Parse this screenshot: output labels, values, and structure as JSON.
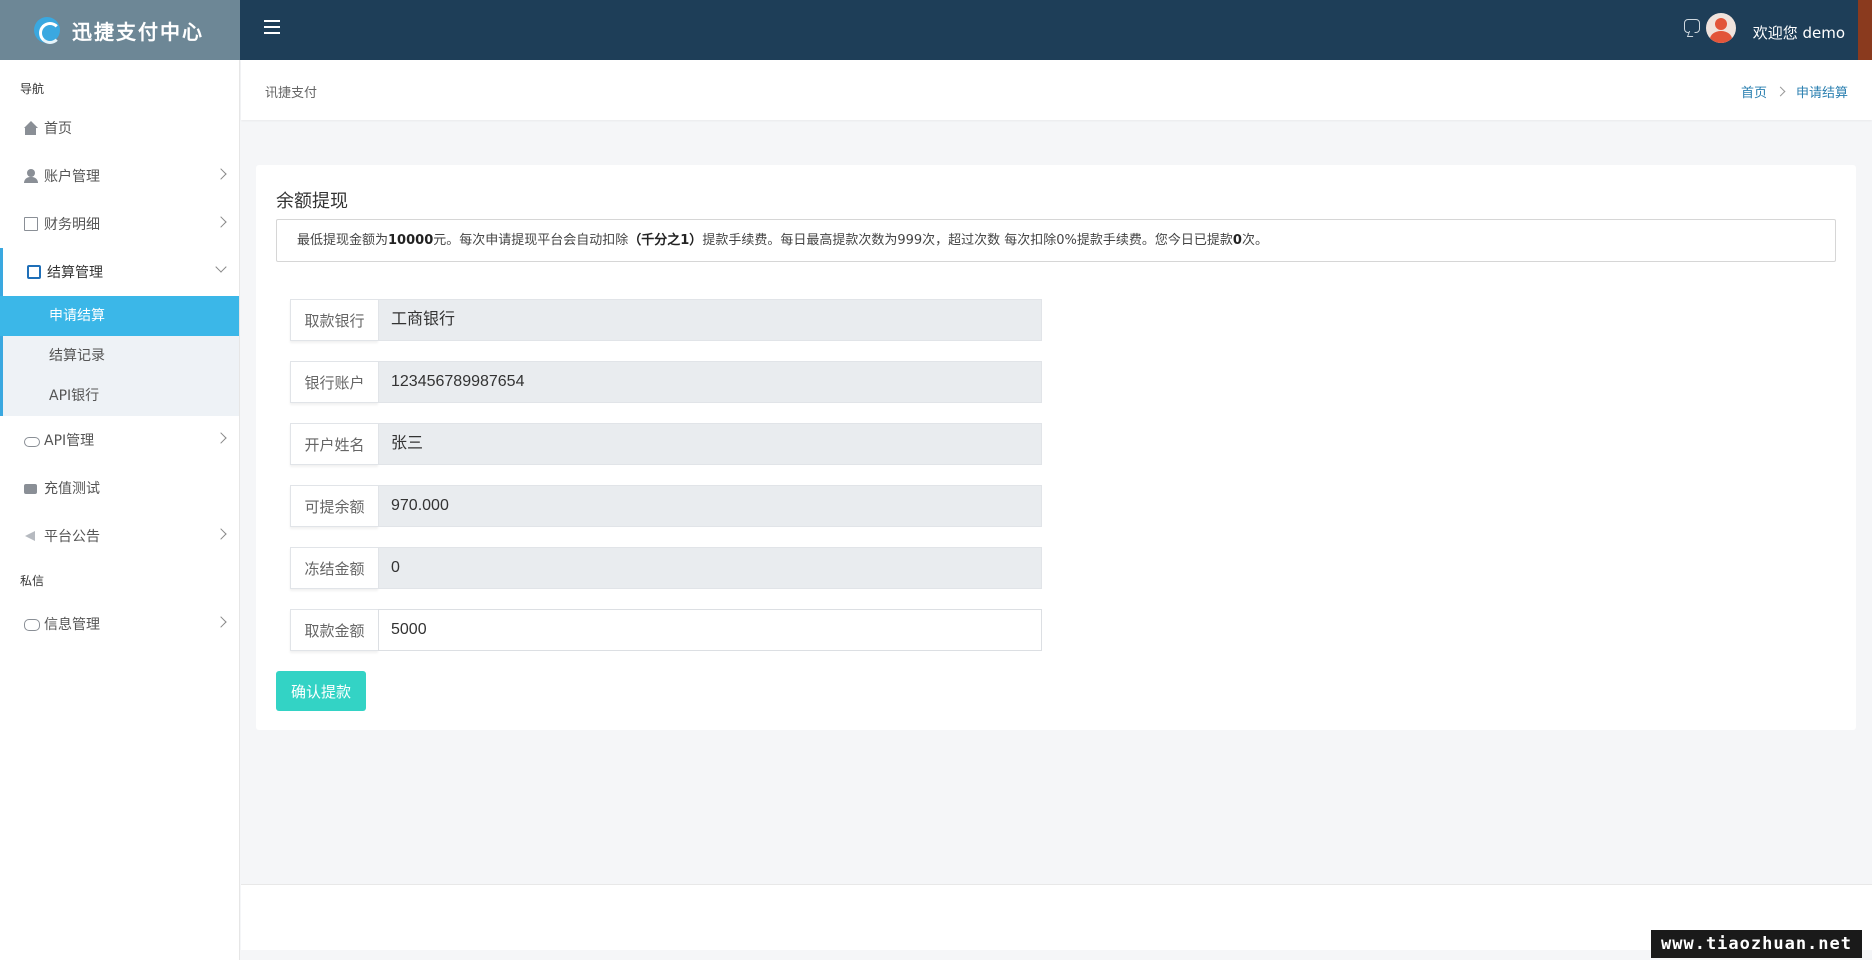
{
  "brand": {
    "title": "迅捷支付中心"
  },
  "header": {
    "welcome": "欢迎您 demo"
  },
  "sidebar": {
    "section_nav": "导航",
    "section_private": "私信",
    "items": [
      {
        "label": "首页"
      },
      {
        "label": "账户管理"
      },
      {
        "label": "财务明细"
      },
      {
        "label": "结算管理"
      },
      {
        "label": "API管理"
      },
      {
        "label": "充值测试"
      },
      {
        "label": "平台公告"
      },
      {
        "label": "信息管理"
      }
    ],
    "settlement_sub": [
      {
        "label": "申请结算"
      },
      {
        "label": "结算记录"
      },
      {
        "label": "API银行"
      }
    ]
  },
  "breadcrumb": {
    "left": "讯捷支付",
    "home": "首页",
    "current": "申请结算"
  },
  "card": {
    "title": "余额提现",
    "notice": {
      "p1": "最低提现金额为",
      "min_amount": "10000",
      "p2": "元。每次申请提现平台会自动扣除",
      "fee_rate": "（千分之1）",
      "p3": "提款手续费。每日最高提款次数为999次，超过次数 每次扣除0%提款手续费。您今日已提款",
      "today_count": "0",
      "p4": "次。"
    },
    "fields": [
      {
        "label": "取款银行",
        "value": "工商银行"
      },
      {
        "label": "银行账户",
        "value": "123456789987654"
      },
      {
        "label": "开户姓名",
        "value": "张三"
      },
      {
        "label": "可提余额",
        "value": "970.000"
      },
      {
        "label": "冻结金额",
        "value": "0"
      },
      {
        "label": "取款金额",
        "value": "5000"
      }
    ],
    "submit_label": "确认提款"
  },
  "watermark": "www.tiaozhuan.net",
  "colors": {
    "topbar": "#1e3e58",
    "brand_bg": "#6d8796",
    "active_menu": "#3bb7e8",
    "submit": "#33d3c5"
  }
}
